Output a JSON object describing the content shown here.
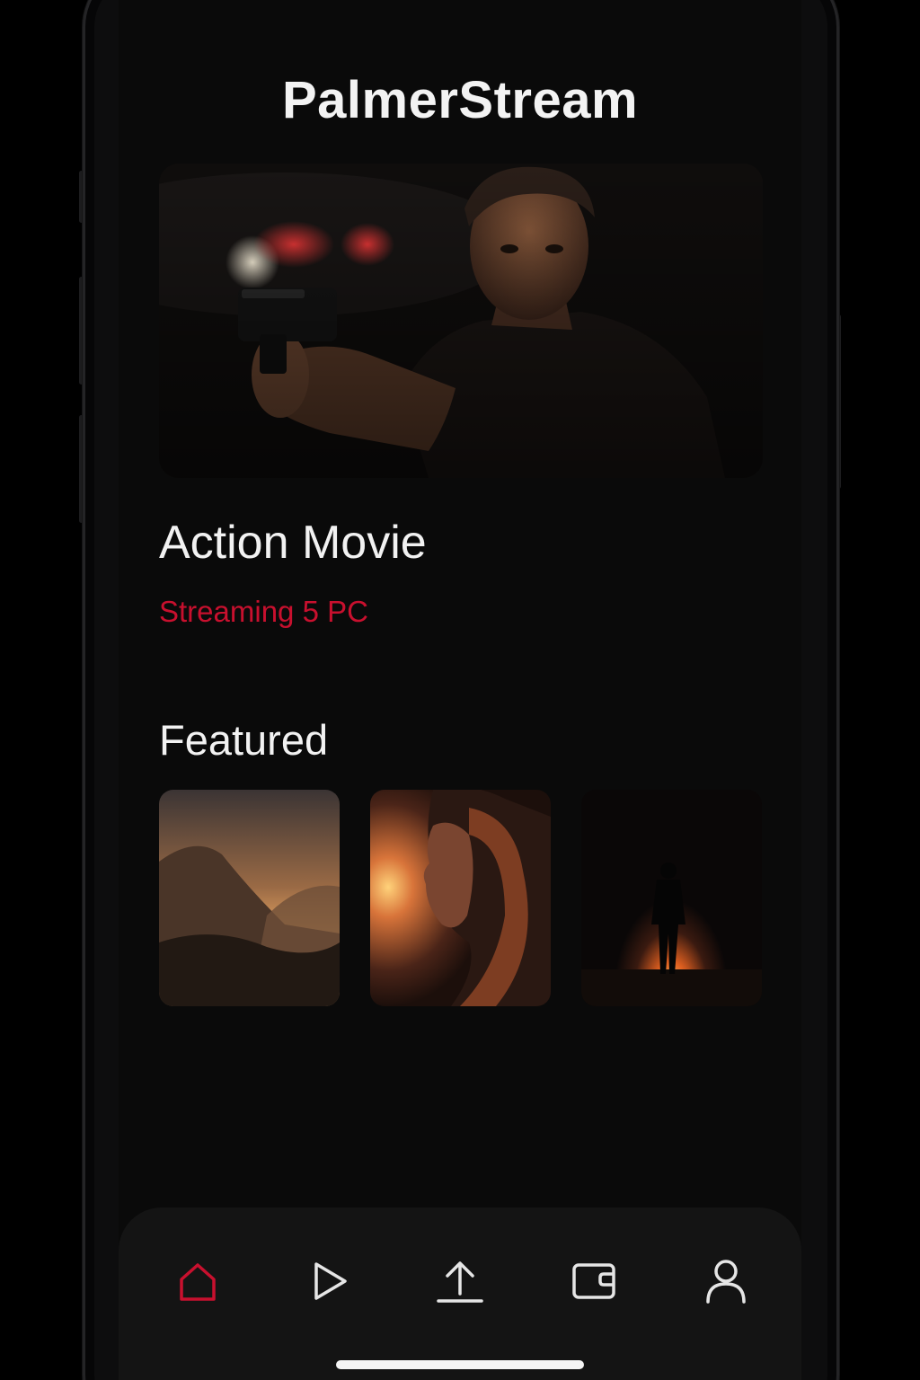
{
  "app": {
    "title": "PalmerStream"
  },
  "hero": {
    "title": "Action Movie",
    "subtitle": "Streaming 5 PC"
  },
  "featured": {
    "heading": "Featured",
    "items": [
      {
        "kind": "mountain-sunset-image"
      },
      {
        "kind": "woman-sunset-portrait-image"
      },
      {
        "kind": "figure-fire-silhouette-image"
      }
    ]
  },
  "bottom_nav": {
    "items": [
      {
        "icon": "home-icon",
        "active": true
      },
      {
        "icon": "play-icon",
        "active": false
      },
      {
        "icon": "upload-icon",
        "active": false
      },
      {
        "icon": "wallet-icon",
        "active": false
      },
      {
        "icon": "profile-icon",
        "active": false
      }
    ]
  },
  "colors": {
    "accent": "#c8102e",
    "background": "#0a0a0a",
    "nav_background": "#141414",
    "icon_inactive": "#e6e6e6"
  }
}
